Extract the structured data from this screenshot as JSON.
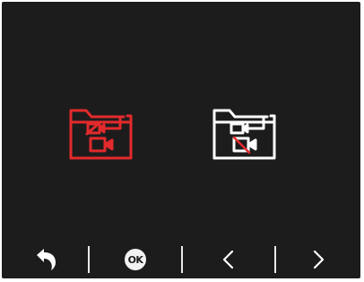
{
  "modes": [
    {
      "icon": "folder-video-moved-icon",
      "state": "selected",
      "color": "#e32a2c"
    },
    {
      "icon": "folder-video-moved-icon",
      "state": "unselected",
      "color": "#ffffff"
    }
  ],
  "bottom_bar": {
    "back_icon": "return-arrow-icon",
    "ok_label": "OK",
    "prev_icon": "chevron-left-icon",
    "next_icon": "chevron-right-icon",
    "icon_color": "#ffffff"
  }
}
